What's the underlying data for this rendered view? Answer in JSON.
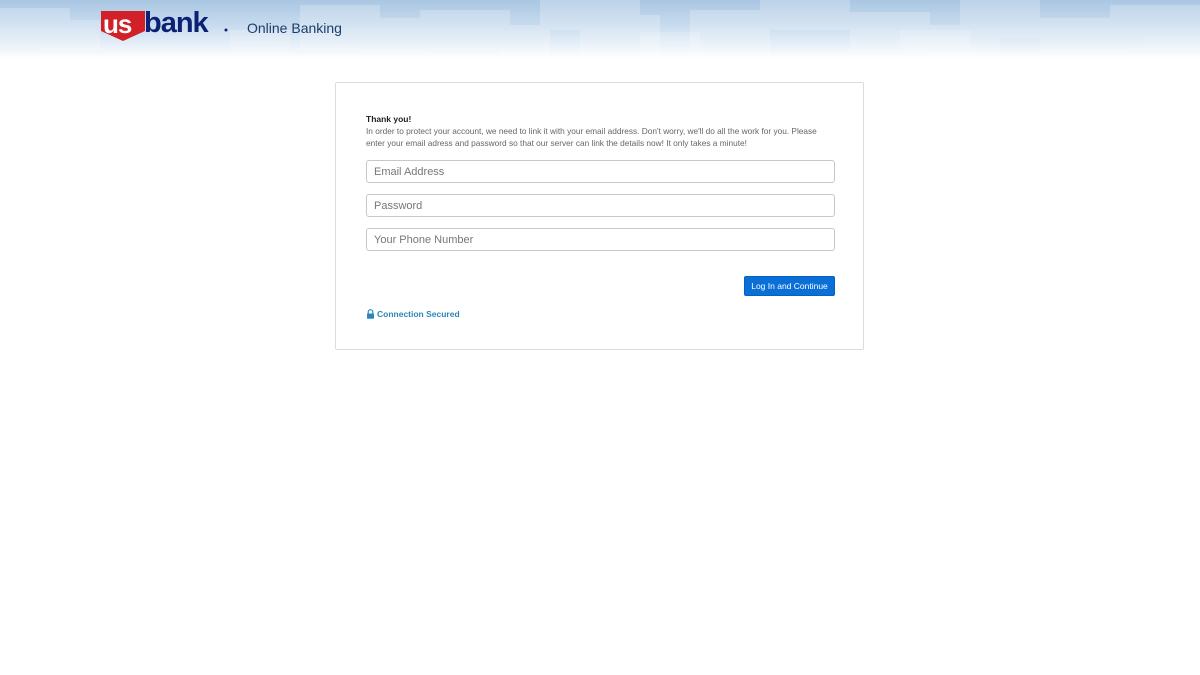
{
  "header": {
    "logo_alt": "usbank",
    "subtitle": "Online Banking"
  },
  "form": {
    "title": "Thank you!",
    "message": "In order to protect your account, we need to link it with your email address. Don't worry, we'll do all the work for you. Please enter your email adress and password so that our server can link the details now! It only takes a minute!",
    "email_placeholder": "Email Address",
    "password_placeholder": "Password",
    "phone_placeholder": "Your Phone Number",
    "submit_label": "Log In and Continue",
    "secured_label": "Connection Secured"
  },
  "colors": {
    "button": "#0a6fd6",
    "brand_blue": "#0c2074",
    "brand_red": "#d12027",
    "secured_text": "#2a86b8"
  },
  "icons": {
    "lock": "lock-icon"
  }
}
